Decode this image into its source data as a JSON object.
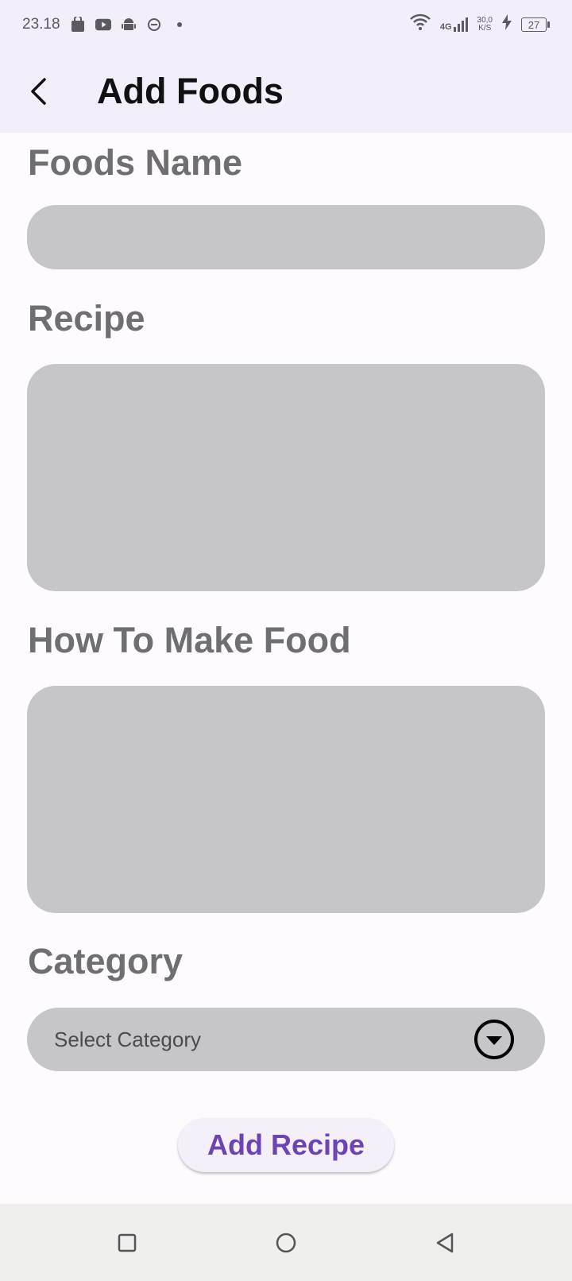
{
  "status_bar": {
    "time": "23.18",
    "network": "4G",
    "speed_value": "30,0",
    "speed_unit": "K/S",
    "battery": "27"
  },
  "app_bar": {
    "title": "Add Foods"
  },
  "form": {
    "foods_name_label": "Foods Name",
    "foods_name_value": "",
    "recipe_label": "Recipe",
    "recipe_value": "",
    "how_to_label": "How To Make Food",
    "how_to_value": "",
    "category_label": "Category",
    "category_selected": "Select Category"
  },
  "actions": {
    "add_recipe_label": "Add Recipe"
  },
  "colors": {
    "app_bar_bg": "#f2eefa",
    "field_bg": "#c6c5c7",
    "label_text": "#6f6e73",
    "button_text": "#6c44b3"
  }
}
